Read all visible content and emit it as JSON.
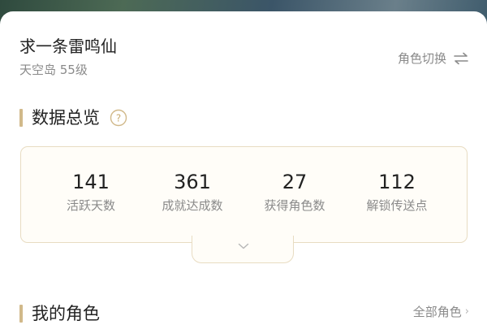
{
  "character": {
    "name": "求一条雷鸣仙",
    "server_level": "天空岛 55级",
    "switch_label": "角色切换",
    "switch_icon": "swap-arrows-icon"
  },
  "overview": {
    "title": "数据总览",
    "help_icon": "question-circle-icon",
    "accent_color": "#d1b98a",
    "stats": [
      {
        "value": "141",
        "label": "活跃天数"
      },
      {
        "value": "361",
        "label": "成就达成数"
      },
      {
        "value": "27",
        "label": "获得角色数"
      },
      {
        "value": "112",
        "label": "解锁传送点"
      }
    ],
    "expand_icon": "chevron-down-icon"
  },
  "my_roles": {
    "title": "我的角色",
    "all_label": "全部角色",
    "more_icon": "chevron-right-icon"
  }
}
